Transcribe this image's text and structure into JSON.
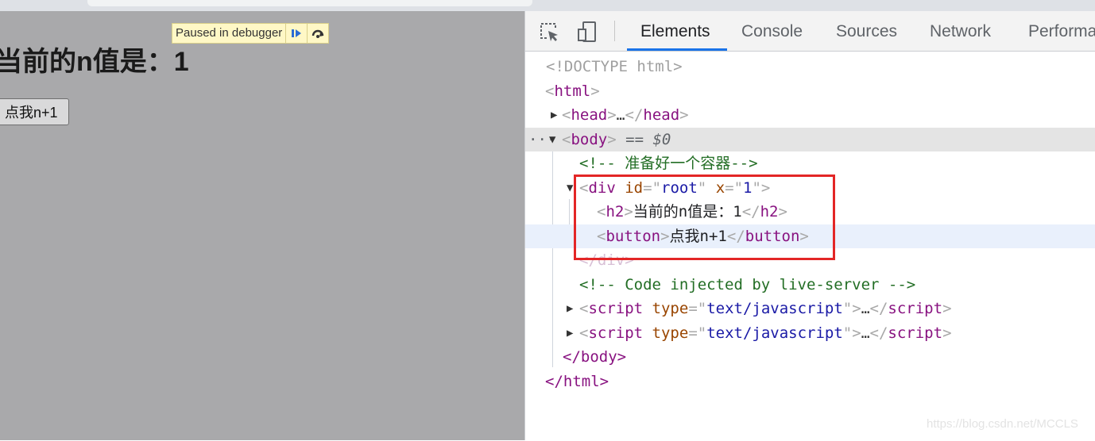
{
  "page": {
    "heading": "当前的n值是：1",
    "button_label": "点我n+1",
    "debugger_banner": "Paused in debugger",
    "resume_icon": "resume-icon",
    "step_over_icon": "step-over-icon"
  },
  "devtools": {
    "tabs": [
      "Elements",
      "Console",
      "Sources",
      "Network",
      "Performa"
    ],
    "active_tab": "Elements",
    "inspect_icon": "inspect-element-icon",
    "device_icon": "device-toolbar-icon",
    "dom": {
      "doctype": "<!DOCTYPE html>",
      "html_open": "html",
      "head_tag": "head",
      "ellipsis": "…",
      "body_tag": "body",
      "selected_marker": "== $0",
      "more_dots": "···",
      "comment_container": "<!-- 准备好一个容器-->",
      "div_tag": "div",
      "div_attrs": [
        {
          "name": "id",
          "value": "root"
        },
        {
          "name": "x",
          "value": "1"
        }
      ],
      "h2_tag": "h2",
      "h2_text": "当前的n值是：1",
      "button_tag": "button",
      "button_text": "点我n+1",
      "div_close": "</div>",
      "comment_live": "<!-- Code injected by live-server -->",
      "script_tag": "script",
      "script_attr_name": "type",
      "script_attr_value": "text/javascript",
      "body_close": "</body>",
      "html_close": "</html>"
    }
  },
  "watermark": "https://blog.csdn.net/MCCLS",
  "colors": {
    "viewport_bg": "#a9a9ab",
    "active_tab_underline": "#1a73e8",
    "highlight_box": "#e32626",
    "tag": "#881280",
    "attr_name": "#994500",
    "attr_value": "#1a1aa6",
    "comment": "#236e25"
  }
}
